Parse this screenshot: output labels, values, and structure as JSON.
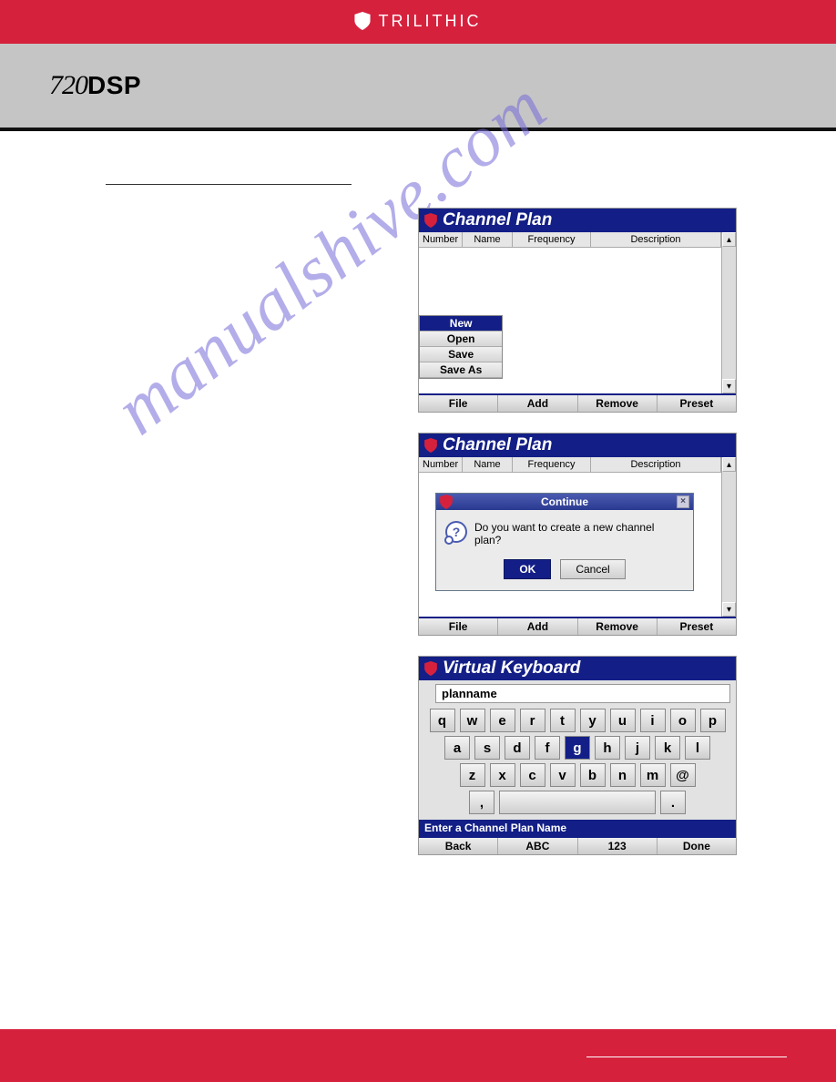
{
  "brand": {
    "name": "TRILITHIC"
  },
  "model": {
    "num": "720",
    "suffix": "DSP"
  },
  "watermark": "manualshive.com",
  "shot1": {
    "title": "Channel Plan",
    "cols": {
      "number": "Number",
      "name": "Name",
      "freq": "Frequency",
      "desc": "Description"
    },
    "menu": {
      "new": "New",
      "open": "Open",
      "save": "Save",
      "saveas": "Save As"
    },
    "toolbar": {
      "file": "File",
      "add": "Add",
      "remove": "Remove",
      "preset": "Preset"
    }
  },
  "shot2": {
    "title": "Channel Plan",
    "cols": {
      "number": "Number",
      "name": "Name",
      "freq": "Frequency",
      "desc": "Description"
    },
    "dialog": {
      "title": "Continue",
      "msg": "Do you want to create a new channel plan?",
      "ok": "OK",
      "cancel": "Cancel"
    },
    "toolbar": {
      "file": "File",
      "add": "Add",
      "remove": "Remove",
      "preset": "Preset"
    }
  },
  "shot3": {
    "title": "Virtual Keyboard",
    "input": "planname",
    "rows": [
      [
        "q",
        "w",
        "e",
        "r",
        "t",
        "y",
        "u",
        "i",
        "o",
        "p"
      ],
      [
        "a",
        "s",
        "d",
        "f",
        "g",
        "h",
        "j",
        "k",
        "l"
      ],
      [
        "z",
        "x",
        "c",
        "v",
        "b",
        "n",
        "m",
        "@"
      ]
    ],
    "selected": "g",
    "comma": ",",
    "period": ".",
    "prompt": "Enter a Channel Plan Name",
    "toolbar": {
      "back": "Back",
      "abc": "ABC",
      "num": "123",
      "done": "Done"
    }
  }
}
